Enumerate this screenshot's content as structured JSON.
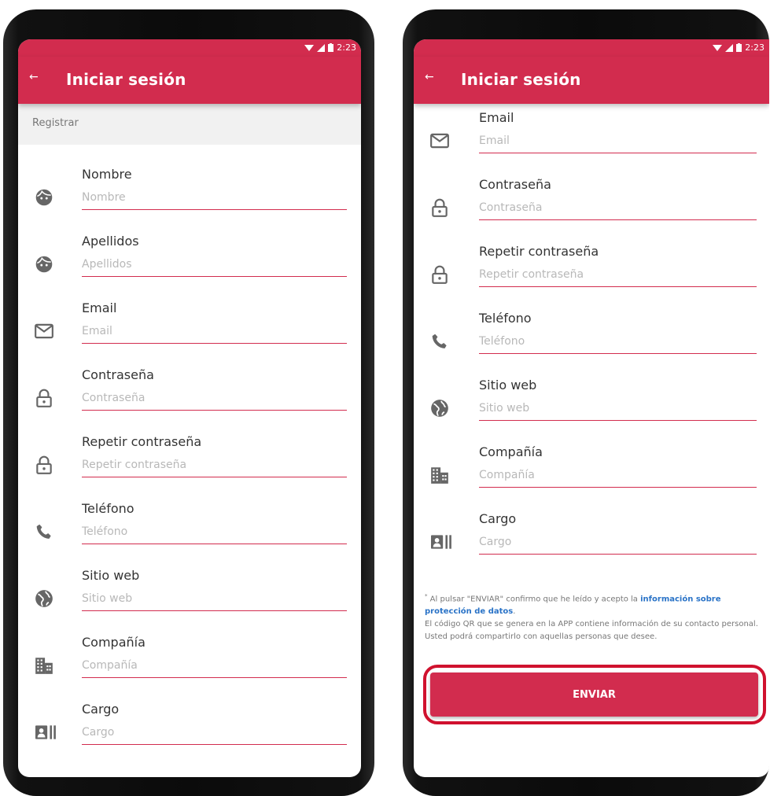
{
  "status_bar": {
    "time": "2:23"
  },
  "app_bar": {
    "back_icon": "back-arrow-icon",
    "title": "Iniciar sesión"
  },
  "section": {
    "header": "Registrar"
  },
  "fields": {
    "nombre": {
      "label": "Nombre",
      "placeholder": "Nombre",
      "icon": "face-icon"
    },
    "apellidos": {
      "label": "Apellidos",
      "placeholder": "Apellidos",
      "icon": "face-icon"
    },
    "email": {
      "label": "Email",
      "placeholder": "Email",
      "icon": "mail-icon"
    },
    "password": {
      "label": "Contraseña",
      "placeholder": "Contraseña",
      "icon": "lock-icon"
    },
    "repeat": {
      "label": "Repetir contraseña",
      "placeholder": "Repetir contraseña",
      "icon": "lock-icon"
    },
    "phone": {
      "label": "Teléfono",
      "placeholder": "Teléfono",
      "icon": "phone-icon"
    },
    "web": {
      "label": "Sitio web",
      "placeholder": "Sitio web",
      "icon": "globe-icon"
    },
    "company": {
      "label": "Compañía",
      "placeholder": "Compañía",
      "icon": "building-icon"
    },
    "cargo": {
      "label": "Cargo",
      "placeholder": "Cargo",
      "icon": "badge-icon"
    }
  },
  "disclaimer": {
    "marker": "*",
    "text_before": " Al pulsar \"ENVIAR\" confirmo que he leído y acepto la ",
    "link": "información sobre protección de datos",
    "text_after": ".",
    "qr_note": "El código QR que se genera en la APP contiene información de su contacto personal. Usted podrá compartirlo con aquellas personas que desee."
  },
  "submit": {
    "label": "ENVIAR"
  },
  "colors": {
    "accent": "#d22c4e",
    "highlight": "#d0112e",
    "link": "#2a73c7"
  }
}
